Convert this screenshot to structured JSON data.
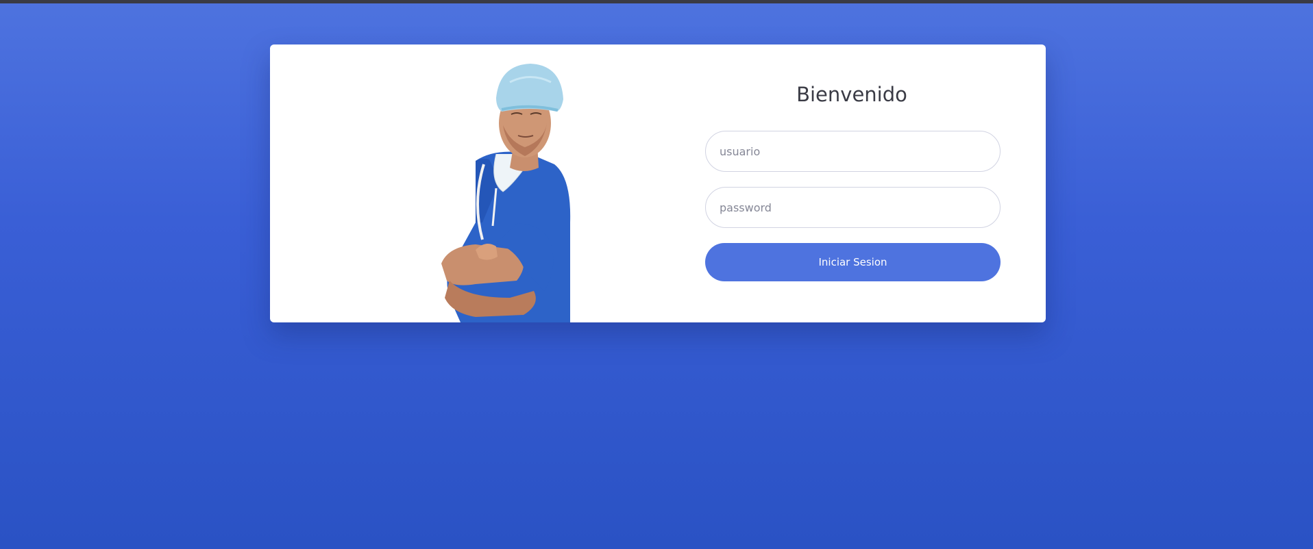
{
  "login": {
    "title": "Bienvenido",
    "username_placeholder": "usuario",
    "password_placeholder": "password",
    "submit_label": "Iniciar Sesion"
  },
  "theme": {
    "primary": "#4e73df",
    "background_top": "#4e73df",
    "background_bottom": "#2a52c4",
    "card": "#ffffff",
    "scrubs": "#2d63c8",
    "cap": "#a8d4ea"
  },
  "illustration": {
    "subject": "doctor-in-scrubs-photo"
  }
}
